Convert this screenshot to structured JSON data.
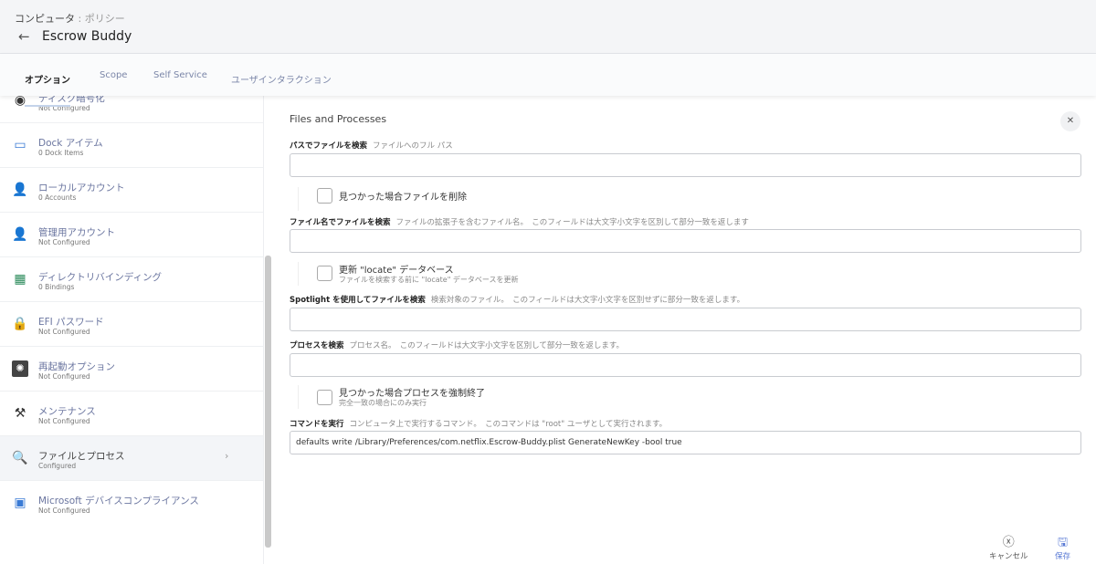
{
  "header": {
    "breadcrumb_parent": "コンピュータ",
    "breadcrumb_sep": ":",
    "breadcrumb_current": "ポリシー",
    "title": "Escrow Buddy"
  },
  "tabs": [
    {
      "label": "オプション"
    },
    {
      "label": "Scope"
    },
    {
      "label": "Self Service"
    },
    {
      "label": "ユーザインタラクション"
    }
  ],
  "sidebar": [
    {
      "name": "ディスク暗号化",
      "status": "Not Configured"
    },
    {
      "name": "Dock アイテム",
      "status": "0 Dock Items"
    },
    {
      "name": "ローカルアカウント",
      "status": "0 Accounts"
    },
    {
      "name": "管理用アカウント",
      "status": "Not Configured"
    },
    {
      "name": "ディレクトリバインディング",
      "status": "0 Bindings"
    },
    {
      "name": "EFI パスワード",
      "status": "Not Configured"
    },
    {
      "name": "再起動オプション",
      "status": "Not Configured"
    },
    {
      "name": "メンテナンス",
      "status": "Not Configured"
    },
    {
      "name": "ファイルとプロセス",
      "status": "Configured"
    },
    {
      "name": "Microsoft デバイスコンプライアンス",
      "status": "Not Configured"
    }
  ],
  "panel": {
    "title": "Files and Processes",
    "search_path": {
      "label": "パスでファイルを検索",
      "hint": "ファイルへのフル パス",
      "value": ""
    },
    "delete_file": {
      "label": "見つかった場合ファイルを削除"
    },
    "search_name": {
      "label": "ファイル名でファイルを検索",
      "hint": "ファイルの拡張子を含むファイル名。　このフィールドは大文字小文字を区別して部分一致を返します",
      "value": ""
    },
    "update_locate": {
      "label": "更新 \"locate\" データベース",
      "sub": "ファイルを検索する前に \"locate\" データベースを更新"
    },
    "spotlight": {
      "label": "Spotlight を使用してファイルを検索",
      "hint": "検索対象のファイル。　このフィールドは大文字小文字を区別せずに部分一致を返します。",
      "value": ""
    },
    "process": {
      "label": "プロセスを検索",
      "hint": "プロセス名。　このフィールドは大文字小文字を区別して部分一致を返します。",
      "value": ""
    },
    "kill_process": {
      "label": "見つかった場合プロセスを強制終了",
      "sub": "完全一致の場合にのみ実行"
    },
    "command": {
      "label": "コマンドを実行",
      "hint": "コンピュータ上で実行するコマンド。　このコマンドは \"root\" ユーザとして実行されます。",
      "value": "defaults write /Library/Preferences/com.netflix.Escrow-Buddy.plist GenerateNewKey -bool true"
    }
  },
  "footer": {
    "cancel": "キャンセル",
    "save": "保存"
  },
  "colors": {
    "accent": "#5b7bd5",
    "link": "#6b76a0"
  }
}
